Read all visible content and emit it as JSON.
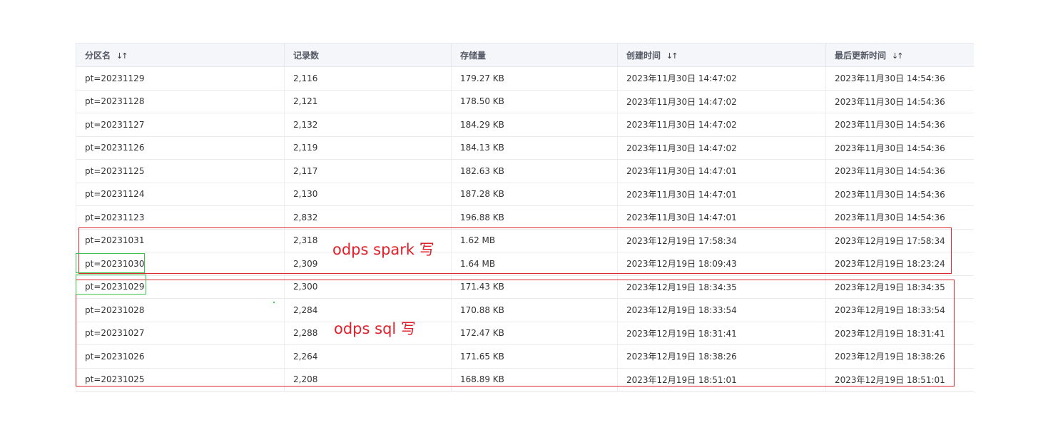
{
  "table": {
    "columns": [
      {
        "label": "分区名",
        "sortable": true
      },
      {
        "label": "记录数",
        "sortable": false
      },
      {
        "label": "存储量",
        "sortable": false
      },
      {
        "label": "创建时间",
        "sortable": true
      },
      {
        "label": "最后更新时间",
        "sortable": true
      }
    ],
    "sort_icon": "↓↑",
    "rows": [
      [
        "pt=20231129",
        "2,116",
        "179.27 KB",
        "2023年11月30日 14:47:02",
        "2023年11月30日 14:54:36"
      ],
      [
        "pt=20231128",
        "2,121",
        "178.50 KB",
        "2023年11月30日 14:47:02",
        "2023年11月30日 14:54:36"
      ],
      [
        "pt=20231127",
        "2,132",
        "184.29 KB",
        "2023年11月30日 14:47:02",
        "2023年11月30日 14:54:36"
      ],
      [
        "pt=20231126",
        "2,119",
        "184.13 KB",
        "2023年11月30日 14:47:02",
        "2023年11月30日 14:54:36"
      ],
      [
        "pt=20231125",
        "2,117",
        "182.63 KB",
        "2023年11月30日 14:47:01",
        "2023年11月30日 14:54:36"
      ],
      [
        "pt=20231124",
        "2,130",
        "187.28 KB",
        "2023年11月30日 14:47:01",
        "2023年11月30日 14:54:36"
      ],
      [
        "pt=20231123",
        "2,832",
        "196.88 KB",
        "2023年11月30日 14:47:01",
        "2023年11月30日 14:54:36"
      ],
      [
        "pt=20231031",
        "2,318",
        "1.62 MB",
        "2023年12月19日 17:58:34",
        "2023年12月19日 17:58:34"
      ],
      [
        "pt=20231030",
        "2,309",
        "1.64 MB",
        "2023年12月19日 18:09:43",
        "2023年12月19日 18:23:24"
      ],
      [
        "pt=20231029",
        "2,300",
        "171.43 KB",
        "2023年12月19日 18:34:35",
        "2023年12月19日 18:34:35"
      ],
      [
        "pt=20231028",
        "2,284",
        "170.88 KB",
        "2023年12月19日 18:33:54",
        "2023年12月19日 18:33:54"
      ],
      [
        "pt=20231027",
        "2,288",
        "172.47 KB",
        "2023年12月19日 18:31:41",
        "2023年12月19日 18:31:41"
      ],
      [
        "pt=20231026",
        "2,264",
        "171.65 KB",
        "2023年12月19日 18:38:26",
        "2023年12月19日 18:38:26"
      ],
      [
        "pt=20231025",
        "2,208",
        "168.89 KB",
        "2023年12月19日 18:51:01",
        "2023年12月19日 18:51:01"
      ]
    ]
  },
  "annotations": {
    "spark_label": "odps spark 写",
    "sql_label": "odps sql 写",
    "red_color": "#d9282f",
    "green_color": "#3cc34a"
  }
}
